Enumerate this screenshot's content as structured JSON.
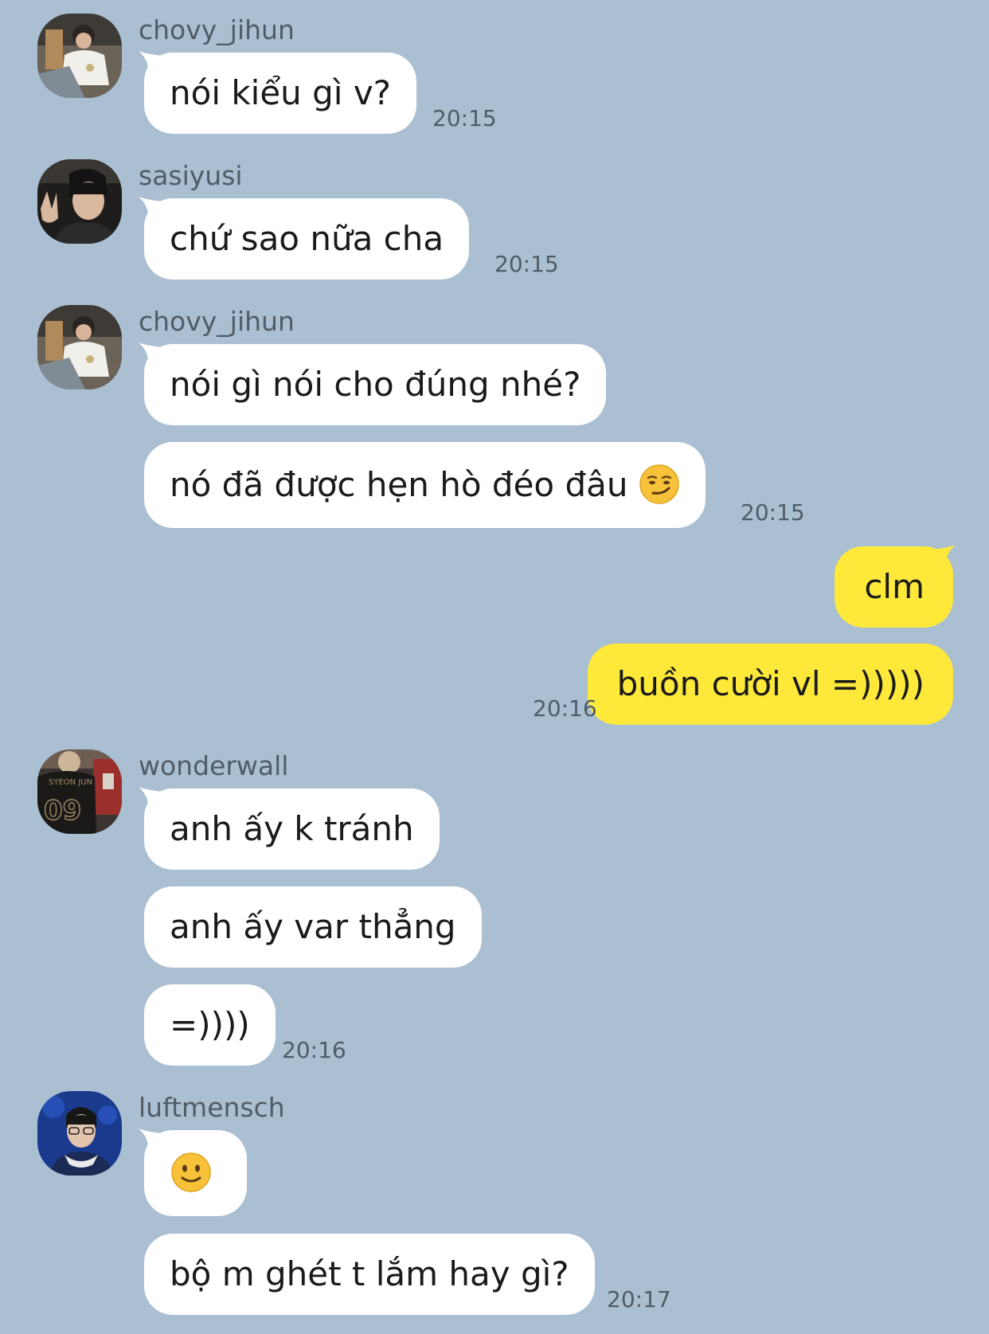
{
  "colors": {
    "background": "#aabfd2",
    "incoming_bubble": "#ffffff",
    "outgoing_bubble": "#fee93a",
    "meta_text": "#4f5c68"
  },
  "messages": [
    {
      "sender": "chovy_jihun",
      "text": "nói kiểu gì v?",
      "time": "20:15"
    },
    {
      "sender": "sasiyusi",
      "text": "chứ sao nữa cha",
      "time": "20:15"
    },
    {
      "sender": "chovy_jihun",
      "text": "nói gì nói cho đúng nhé?"
    },
    {
      "text": "nó đã được hẹn hò đéo đâu",
      "emoji": "smirking-face",
      "time": "20:15"
    },
    {
      "own": true,
      "text": "clm"
    },
    {
      "own": true,
      "text": "buồn cười vl =)))))",
      "time": "20:16"
    },
    {
      "sender": "wonderwall",
      "text": "anh ấy k tránh"
    },
    {
      "text": "anh ấy var thẳng"
    },
    {
      "text": "=))))",
      "time": "20:16"
    },
    {
      "sender": "luftmensch",
      "emoji": "slightly-smiling-face"
    },
    {
      "text": "bộ m ghét t lắm hay gì?",
      "time": "20:17"
    }
  ],
  "avatars": [
    {
      "user": "chovy_jihun",
      "icon": "user-avatar-icon"
    },
    {
      "user": "sasiyusi",
      "icon": "user-avatar-icon"
    },
    {
      "user": "wonderwall",
      "icon": "user-avatar-icon",
      "jersey_text": "09"
    },
    {
      "user": "luftmensch",
      "icon": "user-avatar-icon"
    }
  ]
}
